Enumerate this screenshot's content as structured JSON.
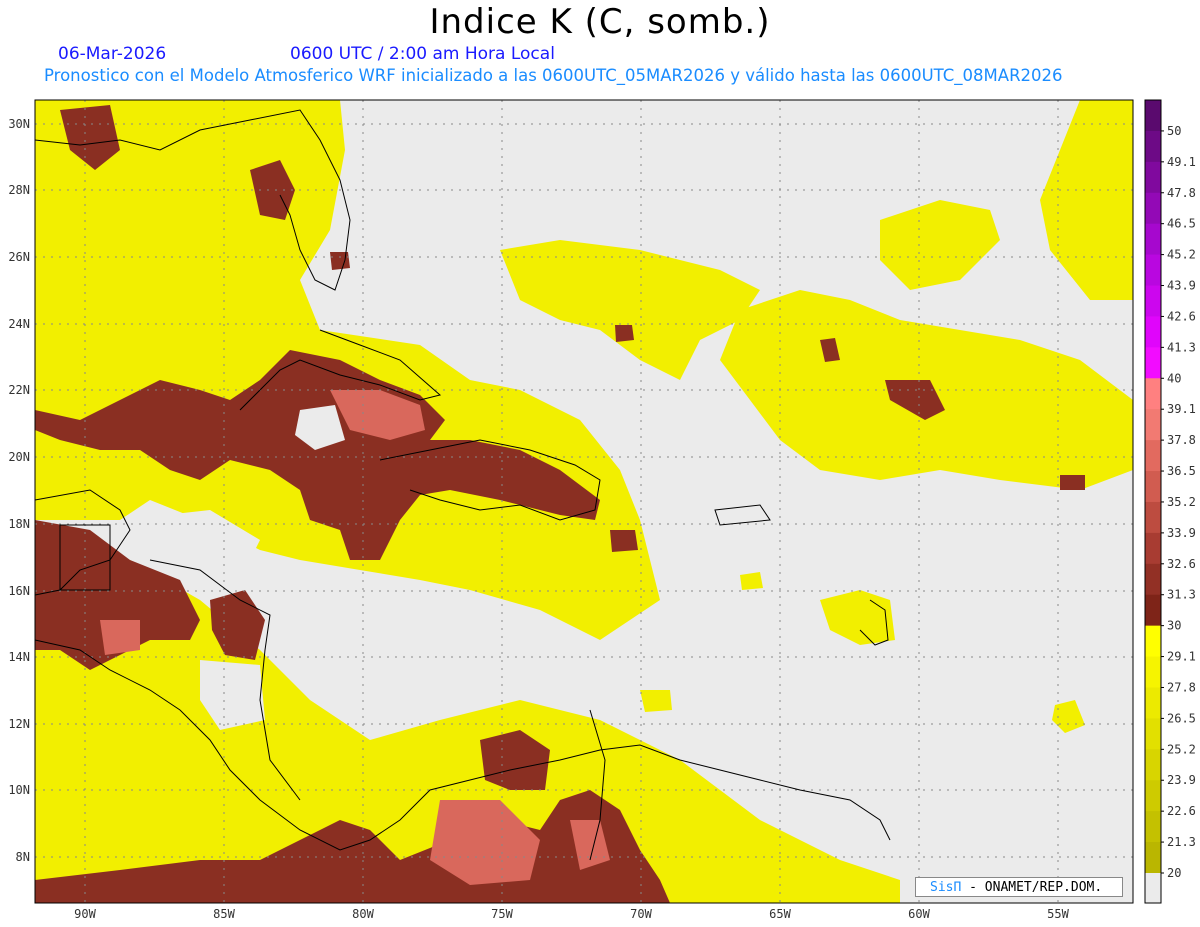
{
  "header": {
    "title": "Indice K (C, somb.)",
    "date": "06-Mar-2026",
    "time": "0600 UTC / 2:00 am Hora Local",
    "description": "Pronostico con el Modelo Atmosferico WRF inicializado a las 0600UTC_05MAR2026 y válido hasta las  0600UTC_08MAR2026"
  },
  "map": {
    "lon_labels": [
      "90W",
      "85W",
      "80W",
      "75W",
      "70W",
      "65W",
      "60W",
      "55W"
    ],
    "lat_labels": [
      "30N",
      "28N",
      "26N",
      "24N",
      "22N",
      "20N",
      "18N",
      "16N",
      "14N",
      "12N",
      "10N",
      "8N"
    ]
  },
  "colorbar": {
    "labels": [
      "50",
      "49.1",
      "47.8",
      "46.5",
      "45.2",
      "43.9",
      "42.6",
      "41.3",
      "40",
      "39.1",
      "37.8",
      "36.5",
      "35.2",
      "33.9",
      "32.6",
      "31.3",
      "30",
      "29.1",
      "27.8",
      "26.5",
      "25.2",
      "23.9",
      "22.6",
      "21.3",
      "20"
    ],
    "colors": [
      "#5a0a6e",
      "#6d0a86",
      "#80099e",
      "#9309b6",
      "#a608ce",
      "#b907e0",
      "#cc06ee",
      "#e005fb",
      "#f20cff",
      "#ff8080",
      "#f27a72",
      "#e26a5f",
      "#d15c50",
      "#bd4c40",
      "#a83c32",
      "#923025",
      "#7e2418",
      "#ffff00",
      "#f6f400",
      "#ecea00",
      "#e2e000",
      "#d8d500",
      "#cecb00",
      "#c4c100",
      "#bab600"
    ]
  },
  "credit": {
    "logo": "SisΠ",
    "text": " - ONAMET/REP.DOM."
  }
}
